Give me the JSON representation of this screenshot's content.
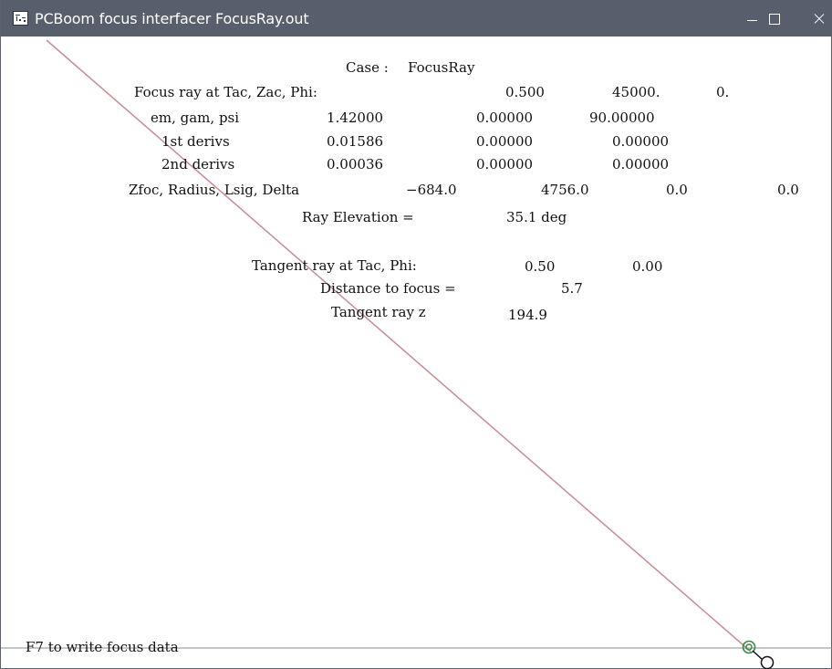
{
  "window": {
    "title": "PCBoom focus interfacer FocusRay.out",
    "icon": "pcboom-app-icon",
    "controls": [
      "minimize-icon",
      "maximize-icon",
      "close-icon"
    ]
  },
  "report": {
    "case_label": "Case :",
    "case_value": "FocusRay",
    "focus_ray": {
      "label": "Focus ray at Tac, Zac, Phi:",
      "values": [
        "0.500",
        "45000.",
        "0."
      ]
    },
    "em_gam_psi": {
      "label": "em, gam, psi",
      "values": [
        "1.42000",
        "0.00000",
        "90.00000"
      ]
    },
    "first_derivs": {
      "label": "1st derivs",
      "values": [
        "0.01586",
        "0.00000",
        "0.00000"
      ]
    },
    "second_derivs": {
      "label": "2nd derivs",
      "values": [
        "0.00036",
        "0.00000",
        "0.00000"
      ]
    },
    "zfoc": {
      "label": "Zfoc, Radius, Lsig, Delta",
      "values": [
        "−684.0",
        "4756.0",
        "0.0",
        "0.0"
      ]
    },
    "ray_elevation": {
      "label": "Ray Elevation =",
      "value": "35.1 deg"
    },
    "tangent_ray": {
      "label": "Tangent ray at Tac, Phi:",
      "values": [
        "0.50",
        "0.00"
      ]
    },
    "distance": {
      "label": "Distance to focus =",
      "value": "5.7"
    },
    "tangent_z": {
      "label": "Tangent ray z",
      "value": "194.9"
    }
  },
  "footer": {
    "hint": "F7 to write focus data"
  },
  "colors": {
    "titlebar": "#575f6d",
    "ray_line": "#c98a98",
    "ground_line": "#8a8f96",
    "focus_marker": "#2e8b3e",
    "cursor_marker": "#111111"
  }
}
